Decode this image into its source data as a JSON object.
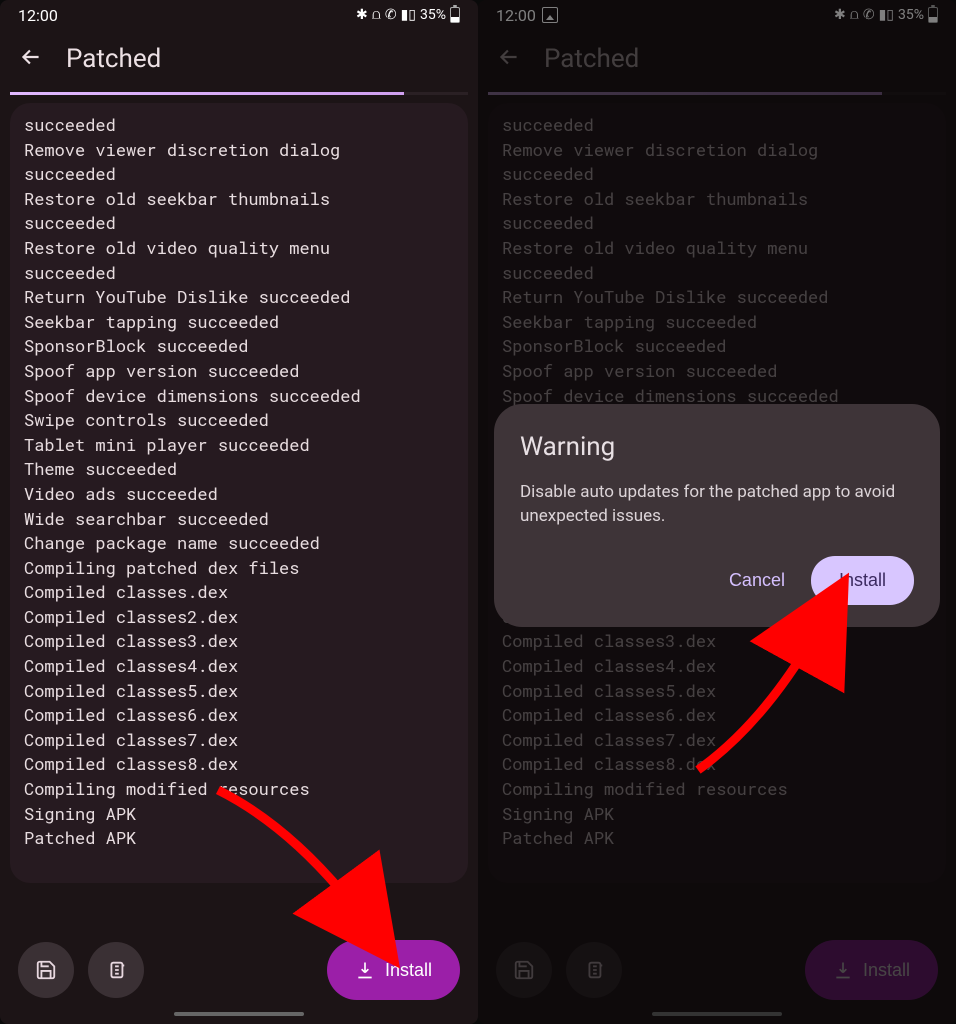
{
  "status": {
    "time": "12:00",
    "battery_pct": "35%",
    "icons": [
      "bluetooth",
      "volte",
      "wifi-call",
      "signal"
    ]
  },
  "header": {
    "title": "Patched"
  },
  "log_lines": [
    "succeeded",
    "Remove viewer discretion dialog",
    "succeeded",
    "Restore old seekbar thumbnails",
    "succeeded",
    "Restore old video quality menu",
    "succeeded",
    "Return YouTube Dislike succeeded",
    "Seekbar tapping succeeded",
    "SponsorBlock succeeded",
    "Spoof app version succeeded",
    "Spoof device dimensions succeeded",
    "Swipe controls succeeded",
    "Tablet mini player succeeded",
    "Theme succeeded",
    "Video ads succeeded",
    "Wide searchbar succeeded",
    "Change package name succeeded",
    "Compiling patched dex files",
    "Compiled classes.dex",
    "Compiled classes2.dex",
    "Compiled classes3.dex",
    "Compiled classes4.dex",
    "Compiled classes5.dex",
    "Compiled classes6.dex",
    "Compiled classes7.dex",
    "Compiled classes8.dex",
    "Compiling modified resources",
    "Signing APK",
    "Patched APK"
  ],
  "buttons": {
    "install": "Install",
    "save_icon": "save-icon",
    "copy_icon": "copy-log-icon"
  },
  "dialog": {
    "title": "Warning",
    "body": "Disable auto updates for the patched app to avoid unexpected issues.",
    "cancel": "Cancel",
    "confirm": "Install"
  }
}
